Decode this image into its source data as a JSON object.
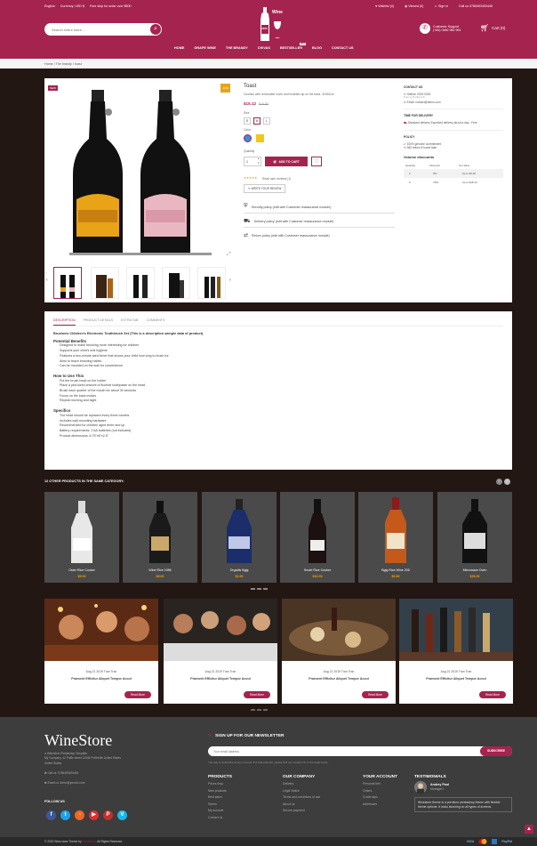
{
  "topbar": {
    "language": "English",
    "currency": "Currency: USD $",
    "free_ship": "Free ship for order over $500",
    "wishlist": "Wishlist (0)",
    "viewed": "Viewed (0)",
    "signin": "Sign in",
    "call": "Call us 0786453453445"
  },
  "search": {
    "placeholder": "Search entire store..."
  },
  "logo": {
    "text": "Wine",
    "sub": "1850"
  },
  "support": {
    "title": "Customer Support",
    "phone": "(+84) 0482 982 961"
  },
  "cart": {
    "label": "Cart (0)"
  },
  "nav": [
    "HOME",
    "GRAPE WINE",
    "THE BRANDY",
    "CHIVAS",
    "BESTSELLER",
    "BLOG",
    "CONTACT US"
  ],
  "nav_badge": "HOT",
  "breadcrumb": [
    "Home",
    "The brandy",
    "toast"
  ],
  "product": {
    "new_badge": "NEW",
    "discount_badge": "-10%",
    "name": "Toast",
    "short_desc": "Cushion with removable cover and invisible zip on the back. 32x32cm",
    "price": "$15.12",
    "old_price": "$16.80",
    "size_label": "Size",
    "sizes": [
      "S",
      "M",
      "L"
    ],
    "color_label": "Color",
    "quantity_label": "Quantity",
    "quantity": "1",
    "add_to_cart": "ADD TO CART",
    "reviews": "Read user reviews (1)",
    "write_review": "WRITE YOUR REVIEW",
    "rating": 5,
    "policies": [
      "Security policy (edit with Customer reassurance module)",
      "Delivery policy (edit with Customer reassurance module)",
      "Return policy (edit with Customer reassurance module)"
    ],
    "expand_icon": "expand-icon"
  },
  "sidebox": {
    "contact_title": "CONTACT US",
    "hotline": "Hotline: 0000 0000",
    "hotline_sub": "8 am to 4h what to 8",
    "email": "Email: contact@demo.com",
    "delivery_title": "TIME FOR DELIVERY",
    "delivery_text": "Standard delivery Expected delivery about a day - Free",
    "policy_title": "POLICY",
    "policy_1": "100% genuine commitment",
    "policy_2": "365 refund if found fake",
    "volume_title": "Volume discounts",
    "volume_headers": [
      "Quantity",
      "Discount",
      "You Save"
    ],
    "volume_rows": [
      [
        "2",
        "8%",
        "Up to $3.02"
      ],
      [
        "5",
        "25%",
        "Up to $18.12"
      ]
    ]
  },
  "tabs": [
    "DESCRIPTION",
    "PRODUCT DETAILS",
    "EXTRA TAB",
    "COMMENTS"
  ],
  "description": {
    "heading": "Brushees Children's Electronic Toothbrush Set (This is a description sample data of product)",
    "s1_title": "Potential Benefits",
    "s1": [
      "Designed to make brushing more interesting for children",
      "Supports your child's oral hygiene",
      "Features a two-minute sand timer that shows your child how long to brush for",
      "Aims to teach brushing habits",
      "Can be mounted on the wall for convenience"
    ],
    "s2_title": "How to Use This",
    "s2": [
      "Put the brush head on the holder",
      "Place a pea-sized amount of fluoride toothpaste on the head",
      "Brush each quarter of the mouth for about 30 seconds",
      "Focus on the back molars",
      "Repeat morning and night"
    ],
    "s3_title": "Specifics",
    "s3": [
      "The head should be replaced every three months",
      "Includes wall-mounting hardware",
      "Recommended for children aged three and up",
      "Battery requirements: 2 AA batteries (not included)",
      "Product dimensions: 6.75\"x6\"x2.5\""
    ]
  },
  "related": {
    "title": "12 OTHER PRODUCTS IN THE SAME CATEGORY:",
    "items": [
      {
        "name": "Oster Rice Cooker",
        "price": "$9.00"
      },
      {
        "name": "Wine Rice 1986",
        "price": "$9.00"
      },
      {
        "name": "Orgadis Bgig",
        "price": "$2.00"
      },
      {
        "name": "Smart Rice Cooker",
        "price": "$16.00"
      },
      {
        "name": "Bgig Rice Wine 205",
        "price": "$9.80"
      },
      {
        "name": "Microwave Oven",
        "price": "$35.00"
      }
    ]
  },
  "blog": {
    "items": [
      {
        "date": "Aug 21 2019",
        "author": "Tran Tran",
        "title": "Praesent Efficitur Aliquet Tempor Accut",
        "more": "Read More"
      },
      {
        "date": "Aug 21 2019",
        "author": "Tran Tran",
        "title": "Praesent Efficitur Aliquet Tempor Accut",
        "more": "Read More"
      },
      {
        "date": "Aug 21 2019",
        "author": "Tran Tran",
        "title": "Praesent Efficitur Aliquet Tempor Accut",
        "more": "Read More"
      },
      {
        "date": "Aug 21 2019",
        "author": "Tran Tran",
        "title": "Praesent Efficitur Aliquet Tempor Accut",
        "more": "Read More"
      }
    ]
  },
  "footer": {
    "brand": "WineStore",
    "theme_line": "Winestore Prestashop Template",
    "address": "My Company, 42 Puffin street 12345 Puffinville United States",
    "address2": "United States",
    "call": "Call us: 0786453453445",
    "email": "Email us: demo@yourdo.com",
    "follow": "FOLLOW US",
    "newsletter_title": "SIGN UP FOR OUR NEWSLETTER",
    "newsletter_placeholder": "Your email address",
    "subscribe": "SUBSCRIBE",
    "newsletter_note": "You may unsubscribe at any moment. For that purpose, please find our contact info in the legal notice.",
    "col1_title": "PRODUCTS",
    "col1": [
      "Prices drop",
      "New products",
      "Best sales",
      "Stores",
      "My account",
      "Contact us"
    ],
    "col2_title": "OUR COMPANY",
    "col2": [
      "Delivery",
      "Legal Notice",
      "Terms and conditions of use",
      "About us",
      "Secure payment"
    ],
    "col3_title": "YOUR ACCOUNT",
    "col3": [
      "Personal info",
      "Orders",
      "Credit slips",
      "Addresses"
    ],
    "test_title": "TESTIMONIALS",
    "test_name": "Andrey Paul",
    "test_role": "Manager1",
    "test_quote": "Winestore theme is a premium prestashop theme with flexible theme options. It looks stunning on all types of screens"
  },
  "bottom": {
    "copyright_a": "© 2019 Wine store Theme by",
    "copyright_b": "Prestashop",
    "copyright_c": "All Rights Reserved.",
    "payments": [
      "VISA",
      "PayPal"
    ]
  },
  "colors": {
    "primary": "#a5234f",
    "dark": "#231714",
    "gold": "#e8a317"
  }
}
